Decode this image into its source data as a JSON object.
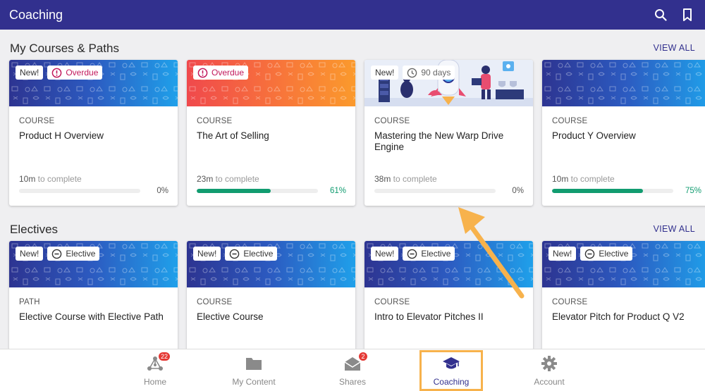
{
  "app": {
    "title": "Coaching"
  },
  "header": {
    "search_icon": "search-icon",
    "bookmark_icon": "bookmark-icon"
  },
  "colors": {
    "primary": "#32308e",
    "progress": "#119c70",
    "overdue": "#c2185b",
    "highlight": "#f7b24c"
  },
  "my_courses": {
    "title": "My Courses & Paths",
    "view_all": "VIEW ALL",
    "cards": [
      {
        "new": "New!",
        "status": "Overdue",
        "type": "COURSE",
        "title": "Product H Overview",
        "time": "10m",
        "time_suffix": " to complete",
        "percent": "0%",
        "progress": 0
      },
      {
        "status": "Overdue",
        "type": "COURSE",
        "title": "The Art of Selling",
        "time": "23m",
        "time_suffix": " to complete",
        "percent": "61%",
        "progress": 61
      },
      {
        "new": "New!",
        "status": "90 days",
        "type": "COURSE",
        "title": "Mastering the New Warp Drive Engine",
        "time": "38m",
        "time_suffix": " to complete",
        "percent": "0%",
        "progress": 0
      },
      {
        "type": "COURSE",
        "title": "Product Y Overview",
        "time": "10m",
        "time_suffix": " to complete",
        "percent": "75%",
        "progress": 75
      }
    ]
  },
  "electives": {
    "title": "Electives",
    "view_all": "VIEW ALL",
    "cards": [
      {
        "new": "New!",
        "status": "Elective",
        "type": "PATH",
        "title": "Elective Course with Elective Path"
      },
      {
        "new": "New!",
        "status": "Elective",
        "type": "COURSE",
        "title": "Elective Course"
      },
      {
        "new": "New!",
        "status": "Elective",
        "type": "COURSE",
        "title": "Intro to Elevator Pitches II"
      },
      {
        "new": "New!",
        "status": "Elective",
        "type": "COURSE",
        "title": "Elevator Pitch for Product Q V2"
      }
    ]
  },
  "bottom_nav": {
    "items": [
      {
        "label": "Home",
        "icon": "network-icon",
        "badge": "22"
      },
      {
        "label": "My Content",
        "icon": "folder-icon"
      },
      {
        "label": "Shares",
        "icon": "envelope-icon",
        "badge": "2"
      },
      {
        "label": "Coaching",
        "icon": "graduation-cap-icon",
        "active": true
      },
      {
        "label": "Account",
        "icon": "gear-icon"
      }
    ]
  }
}
